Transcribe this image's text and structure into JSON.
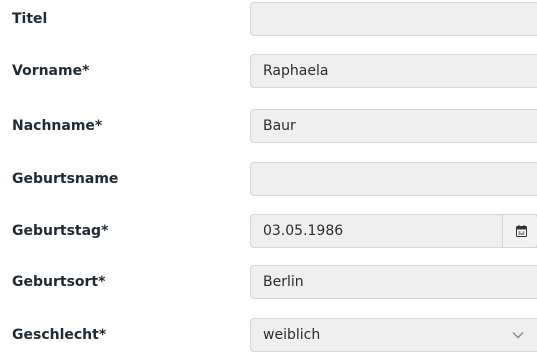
{
  "form": {
    "fields": [
      {
        "label": "Titel",
        "value": ""
      },
      {
        "label": "Vorname*",
        "value": "Raphaela"
      },
      {
        "label": "Nachname*",
        "value": "Baur"
      },
      {
        "label": "Geburtsname",
        "value": ""
      },
      {
        "label": "Geburtstag*",
        "value": "03.05.1986",
        "icon": "calendar-icon"
      },
      {
        "label": "Geburtsort*",
        "value": "Berlin"
      },
      {
        "label": "Geschlecht*",
        "value": "weiblich",
        "icon": "chevron-down-icon"
      }
    ]
  }
}
